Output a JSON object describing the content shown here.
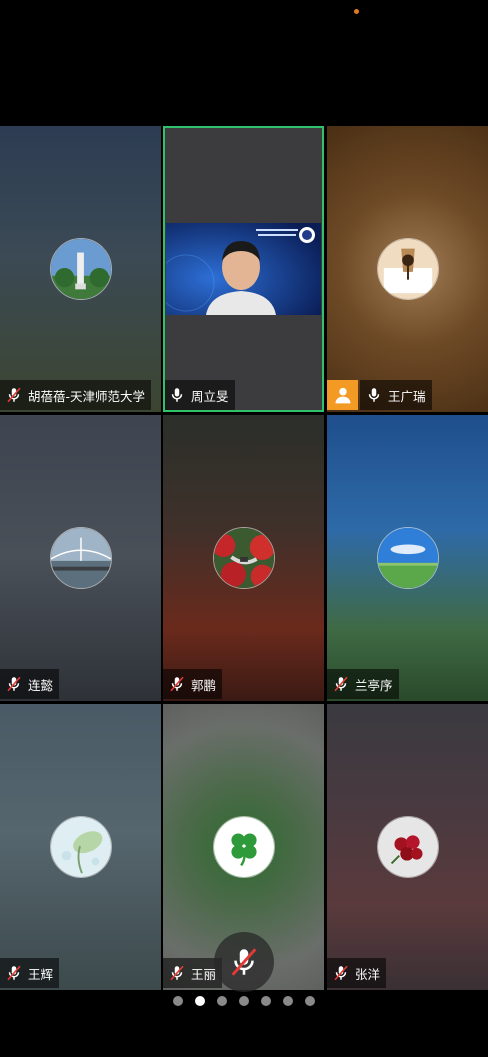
{
  "participants": [
    {
      "name": "胡蓓蓓-天津师范大学",
      "muted": true,
      "avatar": "university-tower-avatar"
    },
    {
      "name": "周立旻",
      "muted": false,
      "video": true,
      "active_speaker": true
    },
    {
      "name": "王广瑞",
      "muted": false,
      "host": true,
      "avatar": "paper-note-avatar"
    },
    {
      "name": "连懿",
      "muted": true,
      "avatar": "bridge-river-avatar"
    },
    {
      "name": "郭鹏",
      "muted": true,
      "avatar": "flower-garden-avatar"
    },
    {
      "name": "兰亭序",
      "muted": true,
      "avatar": "sky-meadow-avatar"
    },
    {
      "name": "王辉",
      "muted": true,
      "avatar": "lotus-leaf-avatar"
    },
    {
      "name": "王丽",
      "muted": true,
      "avatar": "clover-avatar"
    },
    {
      "name": "张洋",
      "muted": true,
      "avatar": "rose-bouquet-avatar"
    }
  ],
  "pager": {
    "count": 7,
    "active_index": 1
  },
  "colors": {
    "active_border": "#2fc26b",
    "host_badge": "#f39a24",
    "camera_dot": "#e07a1f"
  }
}
